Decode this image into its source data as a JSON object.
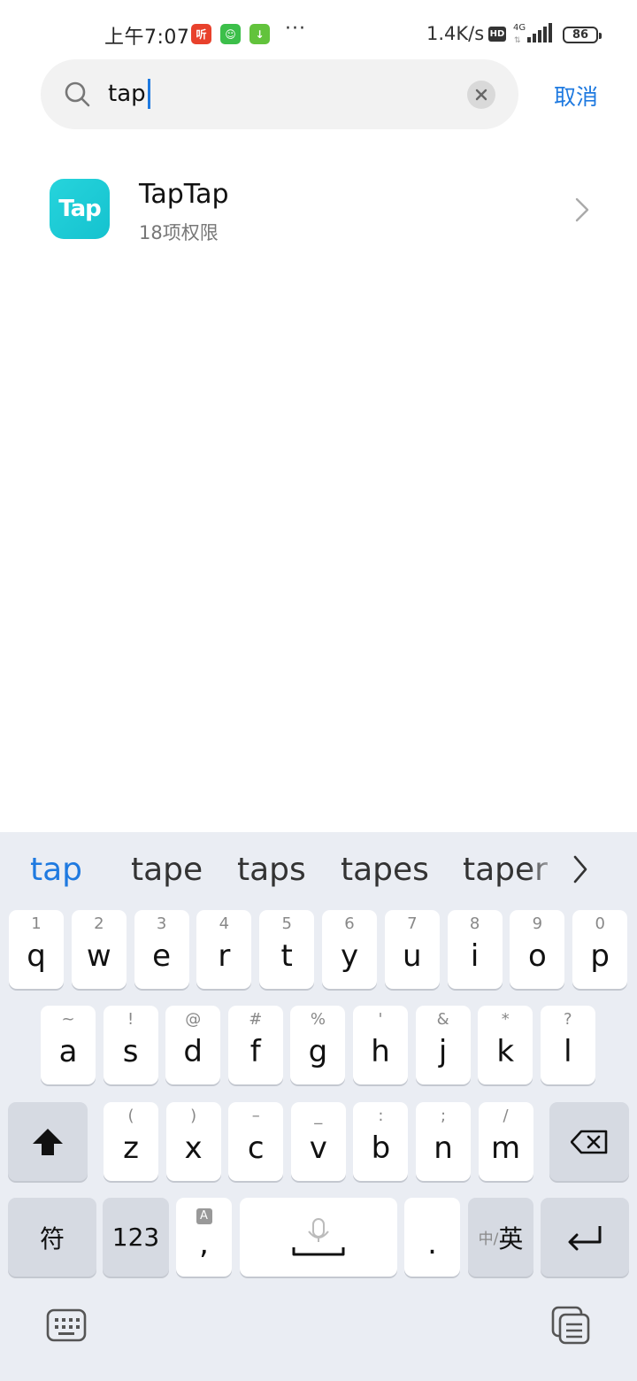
{
  "status_bar": {
    "time": "上午7:07",
    "notif_icons": [
      {
        "name": "listen-app-icon",
        "glyph": "听",
        "color": "#e8412c"
      },
      {
        "name": "green-app-icon",
        "glyph": "☺",
        "color": "#3cbf4a"
      },
      {
        "name": "download-icon",
        "glyph": "↓",
        "color": "#62c33c"
      }
    ],
    "more": "···",
    "net_speed": "1.4K/s",
    "hd": "HD",
    "network": "4G",
    "battery": "86"
  },
  "search": {
    "query": "tap",
    "cancel_label": "取消"
  },
  "results": [
    {
      "app_name": "TapTap",
      "icon_text": "Tap",
      "permissions": "18项权限"
    }
  ],
  "keyboard": {
    "suggestions": [
      "tap",
      "tape",
      "taps",
      "tapes",
      "taper"
    ],
    "row1": [
      {
        "k": "q",
        "h": "1"
      },
      {
        "k": "w",
        "h": "2"
      },
      {
        "k": "e",
        "h": "3"
      },
      {
        "k": "r",
        "h": "4"
      },
      {
        "k": "t",
        "h": "5"
      },
      {
        "k": "y",
        "h": "6"
      },
      {
        "k": "u",
        "h": "7"
      },
      {
        "k": "i",
        "h": "8"
      },
      {
        "k": "o",
        "h": "9"
      },
      {
        "k": "p",
        "h": "0"
      }
    ],
    "row2": [
      {
        "k": "a",
        "h": "~"
      },
      {
        "k": "s",
        "h": "!"
      },
      {
        "k": "d",
        "h": "@"
      },
      {
        "k": "f",
        "h": "#"
      },
      {
        "k": "g",
        "h": "%"
      },
      {
        "k": "h",
        "h": "'"
      },
      {
        "k": "j",
        "h": "&"
      },
      {
        "k": "k",
        "h": "*"
      },
      {
        "k": "l",
        "h": "?"
      }
    ],
    "row3": [
      {
        "k": "z",
        "h": "("
      },
      {
        "k": "x",
        "h": ")"
      },
      {
        "k": "c",
        "h": "–"
      },
      {
        "k": "v",
        "h": "_"
      },
      {
        "k": "b",
        "h": ":"
      },
      {
        "k": "n",
        "h": ";"
      },
      {
        "k": "m",
        "h": "/"
      }
    ],
    "symbol_label": "符",
    "num_label": "123",
    "comma": ",",
    "comma_hint": "A",
    "period": ".",
    "lang_sub": "中/",
    "lang_main": "英"
  },
  "colors": {
    "accent": "#1f7ae0",
    "app_icon": "#15c2cf",
    "keyboard_bg": "#eaedf3"
  }
}
